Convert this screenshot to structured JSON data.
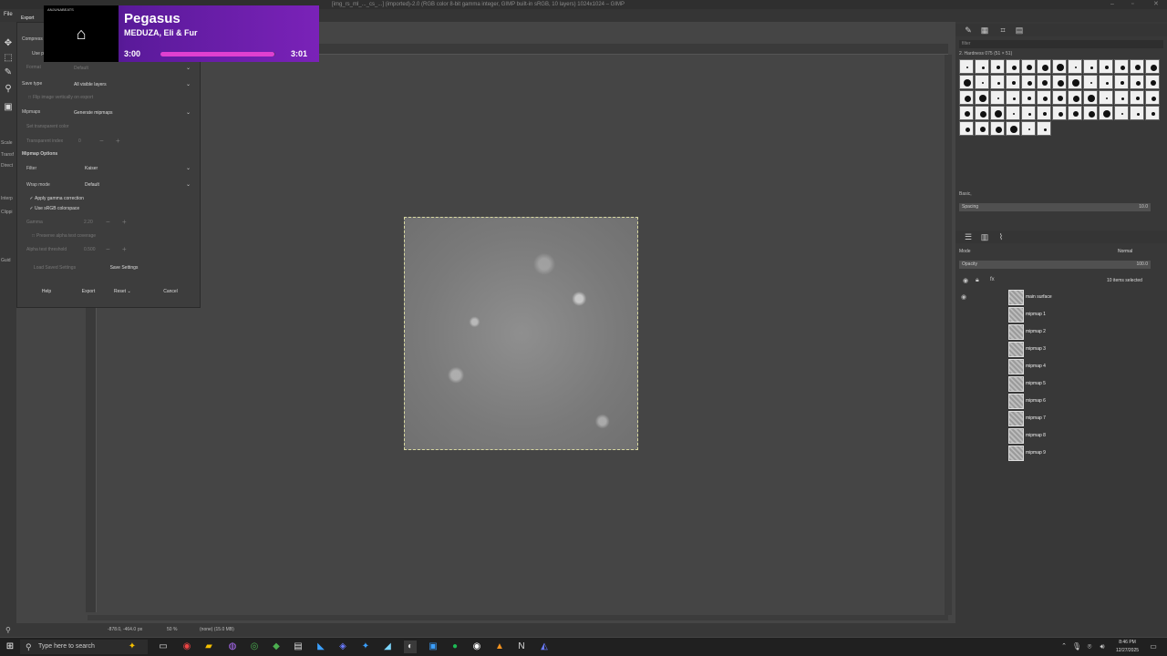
{
  "window": {
    "title": "[img_rs_ml_..._cs_...] (imported)-2.0 (RGB color 8-bit gamma integer, GIMP built-in sRGB, 10 layers) 1024x1024 – GIMP"
  },
  "menubar": {
    "file": "File"
  },
  "toolbox": {
    "options_labels": [
      "Scale",
      "Transf",
      "Direct",
      "Interp",
      "Clippi",
      "Guid"
    ]
  },
  "export_dialog": {
    "tab_label": "Export",
    "compression_label": "Compress",
    "use_label": "Use p",
    "format_label": "Format",
    "format_value": "Default",
    "save_type_label": "Save type",
    "save_type_value": "All visible layers",
    "flip_label": "Flip image vertically on export",
    "mipmaps_label": "Mipmaps",
    "mipmaps_value": "Generate mipmaps",
    "transparent_color_label": "Set transparent color",
    "transparent_index_label": "Transparent index",
    "transparent_index_value": "0",
    "mipmap_options_heading": "Mipmap Options",
    "filter_label": "Filter",
    "filter_value": "Kaiser",
    "wrap_label": "Wrap mode",
    "wrap_value": "Default",
    "gamma_correction_label": "Apply gamma correction",
    "srgb_label": "Use sRGB colorspace",
    "gamma_label": "Gamma",
    "gamma_value": "2.20",
    "preserve_alpha_label": "Preserve alpha test coverage",
    "alpha_threshold_label": "Alpha test threshold",
    "alpha_threshold_value": "0.500",
    "load_settings_label": "Load Saved Settings",
    "save_settings_label": "Save Settings",
    "help_label": "Help",
    "export_label": "Export",
    "reset_label": "Reset",
    "cancel_label": "Cancel"
  },
  "now_playing": {
    "logo_text": "ANJUNABEATS",
    "title": "Pegasus",
    "artist": "MEDUZA, Eli & Fur",
    "elapsed": "3:00",
    "total": "3:01",
    "progress": 0.99,
    "accent_color": "#e040d0"
  },
  "statusbar": {
    "coords": "-878.0, -464.0",
    "unit": "px",
    "zoom": "50 %",
    "info": "(none) (15.0 MB)"
  },
  "dock": {
    "filter_placeholder": "filter",
    "brush_name": "2. Hardness 075 (51 × 51)",
    "tag_label": "Basic,",
    "spacing_label": "Spacing",
    "spacing_value": "10.0",
    "mode_label": "Mode",
    "mode_value": "Normal",
    "opacity_label": "Opacity",
    "opacity_value": "100.0",
    "items_selected": "10 items selected",
    "layers": [
      "main surface",
      "mipmap 1",
      "mipmap 2",
      "mipmap 3",
      "mipmap 4",
      "mipmap 5",
      "mipmap 6",
      "mipmap 7",
      "mipmap 8",
      "mipmap 9"
    ]
  },
  "taskbar": {
    "search_placeholder": "Type here to search",
    "time": "8:46 PM",
    "date": "12/27/2025"
  }
}
